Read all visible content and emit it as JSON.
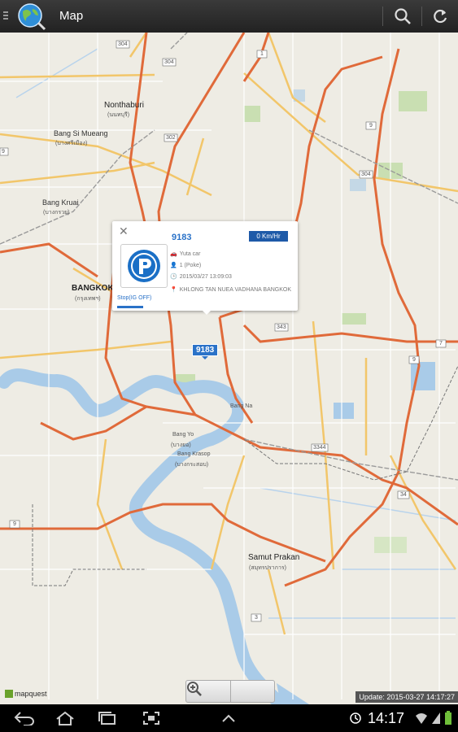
{
  "header": {
    "title": "Map",
    "icons": {
      "menu": "menu-icon",
      "logo": "globe-icon",
      "search": "search-icon",
      "refresh": "refresh-icon"
    }
  },
  "map": {
    "provider": "mapquest",
    "update_text": "Update: 2015-03-27 14:17:27",
    "labels": [
      {
        "text": "Nonthaburi",
        "cls": "big"
      },
      {
        "text": "(นนทบุรี)",
        "cls": "small"
      },
      {
        "text": "Bang Si Mueang",
        "cls": ""
      },
      {
        "text": "(บางศรีเมือง)",
        "cls": "small"
      },
      {
        "text": "Bang Kruai",
        "cls": ""
      },
      {
        "text": "(บางกรวย)",
        "cls": "small"
      },
      {
        "text": "BANGKOK",
        "cls": "big"
      },
      {
        "text": "(กรุงเทพฯ)",
        "cls": "small"
      },
      {
        "text": "Bang Na",
        "cls": "small"
      },
      {
        "text": "Bang Yo",
        "cls": "small"
      },
      {
        "text": "(บางยอ)",
        "cls": "small"
      },
      {
        "text": "Bang Krasop",
        "cls": "small"
      },
      {
        "text": "(บางกระสอบ)",
        "cls": "small"
      },
      {
        "text": "Samut Prakan",
        "cls": "big"
      },
      {
        "text": "(สมุทรปราการ)",
        "cls": "small"
      }
    ],
    "shields": [
      "304",
      "304",
      "1",
      "302",
      "9",
      "304",
      "9",
      "343",
      "9",
      "7",
      "3344",
      "34",
      "3",
      "9"
    ],
    "vehicle_badge": "9183"
  },
  "popup": {
    "title": "9183",
    "speed": "0 Km/Hr",
    "car_type": "Yuta car",
    "driver": "1 (Poke)",
    "datetime": "2015/03/27 13:09:03",
    "location": "KHLONG TAN NUEA VADHANA BANGKOK",
    "status": "Stop(IG OFF)",
    "icon": "parking-icon"
  },
  "zoom": {
    "out": "zoom-out-icon",
    "in": "zoom-in-icon"
  },
  "navbar": {
    "time": "14:17"
  }
}
